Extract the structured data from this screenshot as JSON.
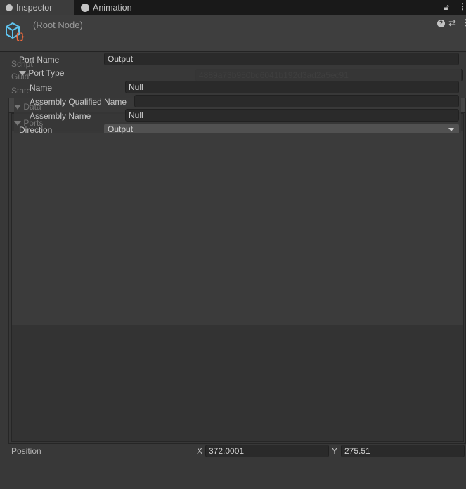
{
  "tabs": [
    {
      "label": "Inspector",
      "icon": "info-icon"
    },
    {
      "label": "Animation",
      "icon": "clock-icon"
    }
  ],
  "header": {
    "title": "(Root Node)"
  },
  "background": {
    "script_label": "Script",
    "guid_label": "Guid",
    "guid_value": "4889a73b950bd6041b192d3ad2a5ec91",
    "state_label": "State",
    "data_label": "Data",
    "ports_label": "Ports"
  },
  "popup": {
    "port_name_label": "Port Name",
    "port_name_value": "Output",
    "port_type_label": "Port Type",
    "name_label": "Name",
    "name_value": "Null",
    "aqn_label": "Assembly Qualified Name",
    "aqn_value": "",
    "assembly_name_label": "Assembly Name",
    "assembly_name_value": "Null",
    "direction_label": "Direction",
    "direction_value": "Output"
  },
  "position": {
    "label": "Position",
    "x_label": "X",
    "x_value": "372.0001",
    "y_label": "Y",
    "y_value": "275.51"
  }
}
